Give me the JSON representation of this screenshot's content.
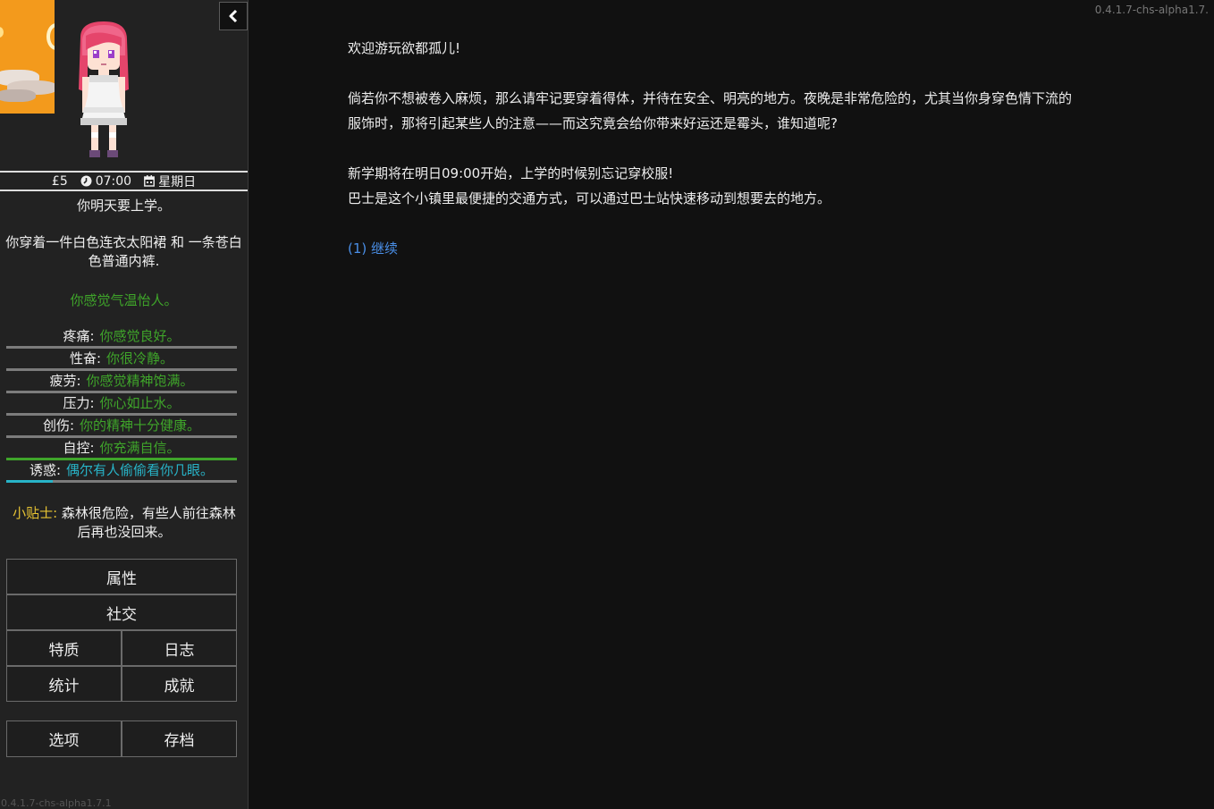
{
  "version": "0.4.1.7-chs-alpha1.7.1",
  "version_top": "0.4.1.7-chs-alpha1.7.",
  "sidebar": {
    "money": "£5",
    "time": "07:00",
    "weekday": "星期日",
    "school_note": "你明天要上学。",
    "clothing": "你穿着一件白色连衣太阳裙 和 一条苍白色普通内裤.",
    "weather": "你感觉气温怡人。",
    "stats": [
      {
        "name": "疼痛:",
        "desc": "你感觉良好。",
        "level": 0,
        "color": "#3fa52a"
      },
      {
        "name": "性奋:",
        "desc": "你很冷静。",
        "level": 0,
        "color": "#3fa52a"
      },
      {
        "name": "疲劳:",
        "desc": "你感觉精神饱满。",
        "level": 0,
        "color": "#3fa52a"
      },
      {
        "name": "压力:",
        "desc": "你心如止水。",
        "level": 0,
        "color": "#3fa52a"
      },
      {
        "name": "创伤:",
        "desc": "你的精神十分健康。",
        "level": 0,
        "color": "#3fa52a"
      },
      {
        "name": "自控:",
        "desc": "你充满自信。",
        "level": 1,
        "color": "#3fa52a"
      },
      {
        "name": "诱惑:",
        "desc": "偶尔有人偷偷看你几眼。",
        "level": 0.2,
        "color": "#28b4c8"
      }
    ],
    "tip_label": "小贴士:",
    "tip_text": "森林很危险，有些人前往森林后再也没回来。",
    "buttons": {
      "attributes": "属性",
      "social": "社交",
      "traits": "特质",
      "journal": "日志",
      "statistics": "统计",
      "achievements": "成就",
      "options": "选项",
      "saves": "存档"
    }
  },
  "main": {
    "welcome": "欢迎游玩欲都孤儿!",
    "para1_line1": "倘若你不想被卷入麻烦，那么请牢记要穿着得体，并待在安全、明亮的地方。夜晚是非常危险的，尤其当你身穿色情下流的",
    "para1_line2": "服饰时，那将引起某些人的注意——而这究竟会给你带来好运还是霉头，谁知道呢?",
    "para2_line1": "新学期将在明日09:00开始，上学的时候别忘记穿校服!",
    "para2_line2": "巴士是这个小镇里最便捷的交通方式，可以通过巴士站快速移动到想要去的地方。",
    "continue": "(1) 继续"
  },
  "colors": {
    "accent_green": "#3fa52a",
    "accent_cyan": "#28b4c8",
    "tip_yellow": "#e7c333",
    "link_blue": "#4a8fe7"
  }
}
